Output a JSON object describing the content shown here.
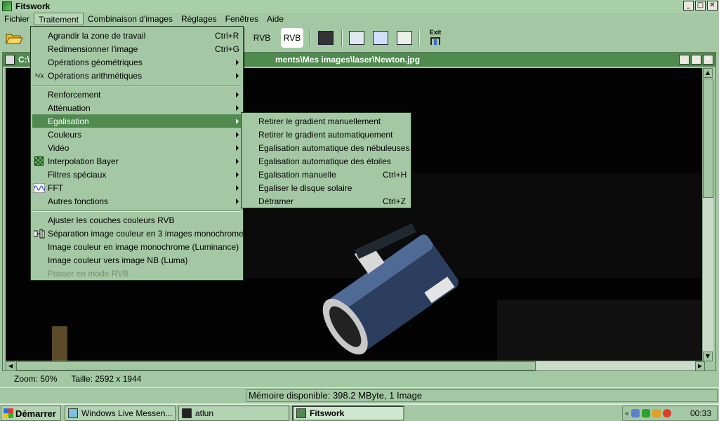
{
  "window": {
    "title": "Fitswork"
  },
  "menubar": [
    "Fichier",
    "Traitement",
    "Combinaison d'images",
    "Réglages",
    "Fenêtres",
    "Aide"
  ],
  "toolbar": {
    "rvb1": "RVB",
    "rvb2": "RVB",
    "exit_label": "Exit"
  },
  "child": {
    "title": "C:\\\\ ... ments\\Mes images\\laser\\Newton.jpg",
    "title_left": "C:\\",
    "title_right": "ments\\Mes images\\laser\\Newton.jpg"
  },
  "traitement_menu": [
    {
      "label": "Agrandir la zone de travail",
      "shortcut": "Ctrl+R"
    },
    {
      "label": "Redimensionner l'image",
      "shortcut": "Ctrl+G"
    },
    {
      "label": "Opérations géométriques",
      "submenu": true
    },
    {
      "label": "Opérations arithmétiques",
      "submenu": true,
      "icon": "sqrt-x-icon"
    },
    {
      "label": "Renforcement",
      "submenu": true
    },
    {
      "label": "Atténuation",
      "submenu": true
    },
    {
      "label": "Egalisation",
      "submenu": true,
      "highlighted": true
    },
    {
      "label": "Couleurs",
      "submenu": true
    },
    {
      "label": "Vidéo",
      "submenu": true
    },
    {
      "label": "Interpolation Bayer",
      "submenu": true,
      "icon": "bayer-grid-icon"
    },
    {
      "label": "Filtres spéciaux",
      "submenu": true
    },
    {
      "label": "FFT",
      "submenu": true,
      "icon": "fft-wave-icon"
    },
    {
      "label": "Autres fonctions",
      "submenu": true
    },
    {
      "label": "Ajuster les couches couleurs RVB"
    },
    {
      "label": "Séparation image couleur en 3 images monochromes",
      "icon": "split-channels-icon"
    },
    {
      "label": "Image couleur en image monochrome (Luminance)"
    },
    {
      "label": "Image couleur vers image NB (Luma)"
    },
    {
      "label": "Passer en mode RVB",
      "disabled": true
    }
  ],
  "egalisation_menu": [
    {
      "label": "Retirer le gradient manuellement"
    },
    {
      "label": "Retirer le gradient automatiquement"
    },
    {
      "label": "Egalisation automatique des nébuleuses"
    },
    {
      "label": "Egalisation automatique des étoiles"
    },
    {
      "label": "Egalisation manuelle",
      "shortcut": "Ctrl+H"
    },
    {
      "label": "Egaliser le disque solaire"
    },
    {
      "label": "Détramer",
      "shortcut": "Ctrl+Z"
    }
  ],
  "status": {
    "zoom": "Zoom: 50%",
    "size": "Taille: 2592 x 1944",
    "memory": "Mémoire disponible: 398.2 MByte, 1 Image"
  },
  "taskbar": {
    "start": "Démarrer",
    "tasks": [
      "Windows Live Messen...",
      "atlun",
      "Fitswork"
    ],
    "clock": "00:33"
  }
}
